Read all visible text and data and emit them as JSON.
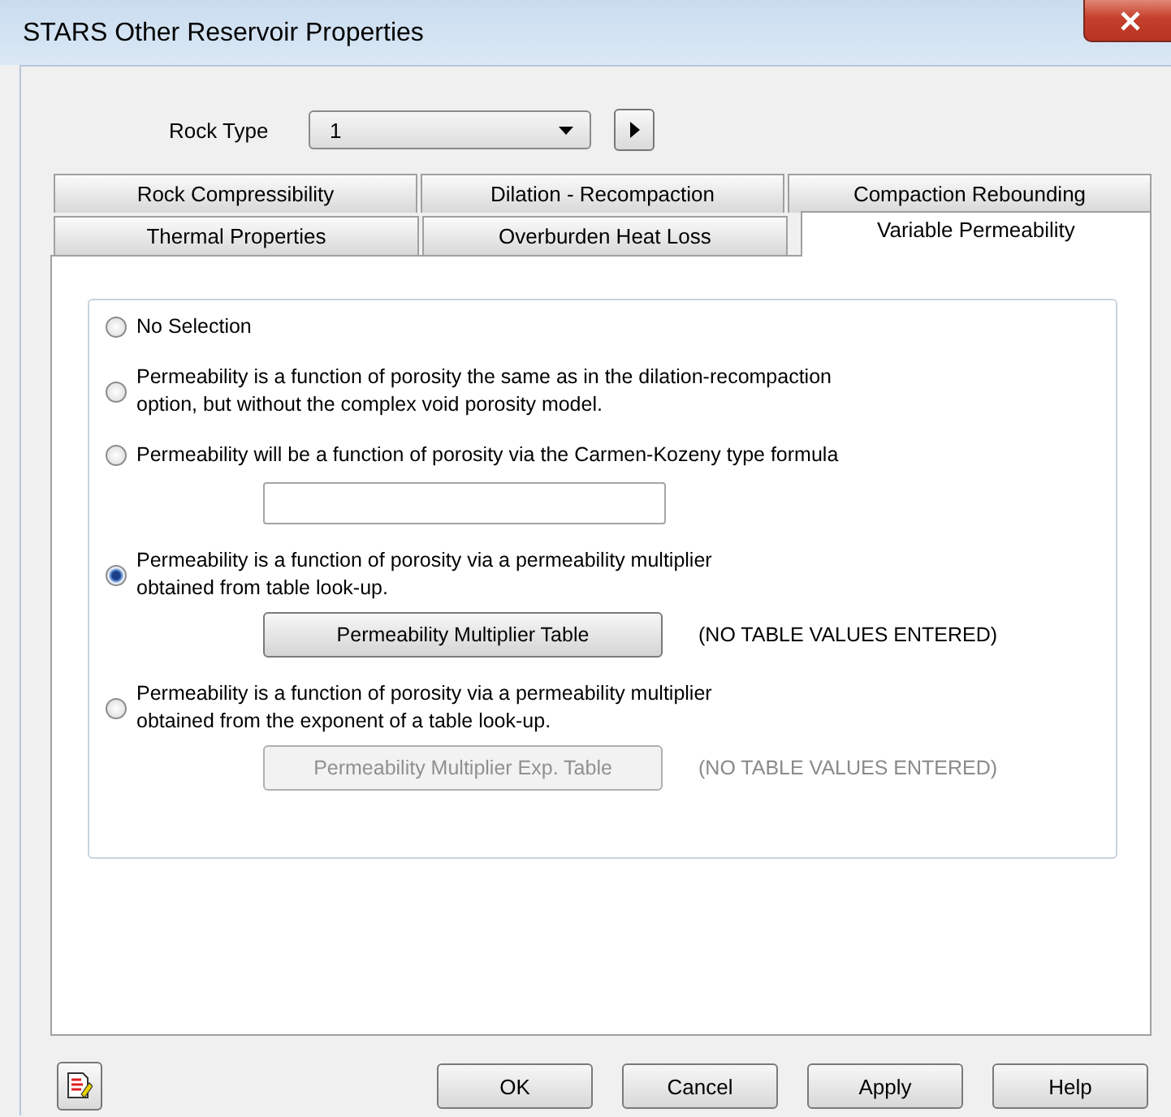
{
  "window": {
    "title": "STARS Other Reservoir Properties"
  },
  "rock_type": {
    "label": "Rock Type",
    "value": "1"
  },
  "tab_rows": [
    [
      {
        "label": "Rock Compressibility",
        "selected": false
      },
      {
        "label": "Dilation - Recompaction",
        "selected": false
      },
      {
        "label": "Compaction Rebounding",
        "selected": false
      }
    ],
    [
      {
        "label": "Thermal Properties",
        "selected": false
      },
      {
        "label": "Overburden Heat Loss",
        "selected": false
      },
      {
        "label": "Variable Permeability",
        "selected": true
      }
    ]
  ],
  "options": [
    {
      "kind": "plain",
      "label": "No Selection",
      "selected": false
    },
    {
      "kind": "plain",
      "label": "Permeability is a function of porosity the same as in the dilation-recompaction\noption, but without the complex void porosity model.",
      "selected": false
    },
    {
      "kind": "field",
      "label": "Permeability will be a function of porosity via the Carmen-Kozeny type formula",
      "selected": false
    },
    {
      "kind": "table",
      "label": "Permeability is a function of porosity via a permeability multiplier\nobtained from table look-up.",
      "selected": true,
      "button": "Permeability Multiplier Table",
      "status": "(NO TABLE VALUES ENTERED)",
      "disabled": false
    },
    {
      "kind": "table",
      "label": "Permeability is a function of porosity via a permeability multiplier\nobtained from the exponent of a table look-up.",
      "selected": false,
      "button": "Permeability Multiplier Exp. Table",
      "status": "(NO TABLE VALUES ENTERED)",
      "disabled": true
    }
  ],
  "buttons": [
    "OK",
    "Cancel",
    "Apply",
    "Help"
  ]
}
